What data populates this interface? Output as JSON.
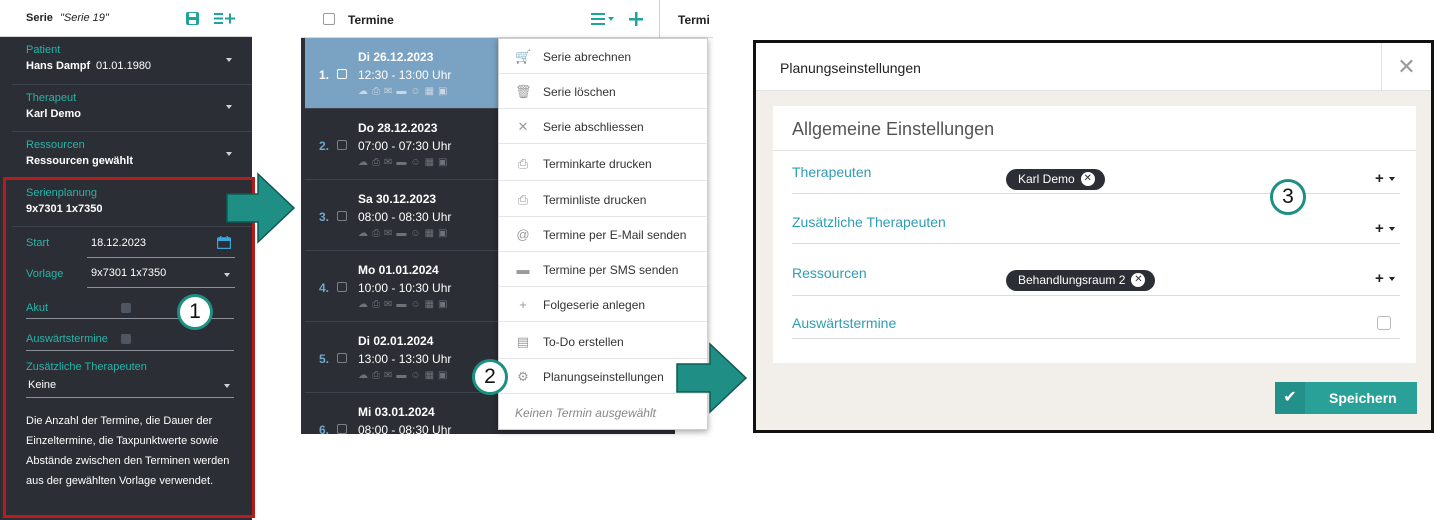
{
  "serie_panel": {
    "header": {
      "label": "Serie",
      "name": "\"Serie 19\""
    },
    "patient": {
      "label": "Patient",
      "name": "Hans Dampf",
      "birthdate": "01.01.1980"
    },
    "therapeut": {
      "label": "Therapeut",
      "value": "Karl Demo"
    },
    "ressourcen": {
      "label": "Ressourcen",
      "value": "Ressourcen gewählt"
    },
    "serienplanung": {
      "label": "Serienplanung",
      "value": "9x7301 1x7350"
    },
    "start": {
      "label": "Start",
      "value": "18.12.2023"
    },
    "vorlage": {
      "label": "Vorlage",
      "value": "9x7301 1x7350"
    },
    "akut": {
      "label": "Akut"
    },
    "auswaertstermine": {
      "label": "Auswärtstermine"
    },
    "zusaetzliche": {
      "label": "Zusätzliche Therapeuten",
      "value": "Keine"
    },
    "description": [
      "Die Anzahl der Termine, die Dauer der",
      "Einzeltermine, die Taxpunktwerte sowie",
      "Abstände zwischen den Terminen werden",
      "aus der gewählten Vorlage verwendet."
    ]
  },
  "termine_panel": {
    "header": {
      "title": "Termine",
      "right_title": "Termi"
    },
    "appointments": [
      {
        "num": "1.",
        "day": "Di 26.12.2023",
        "time": "12:30 - 13:00 Uhr",
        "selected": true
      },
      {
        "num": "2.",
        "day": "Do 28.12.2023",
        "time": "07:00 - 07:30 Uhr",
        "selected": false
      },
      {
        "num": "3.",
        "day": "Sa 30.12.2023",
        "time": "08:00 - 08:30 Uhr",
        "selected": false
      },
      {
        "num": "4.",
        "day": "Mo 01.01.2024",
        "time": "10:00 - 10:30 Uhr",
        "selected": false
      },
      {
        "num": "5.",
        "day": "Di 02.01.2024",
        "time": "13:00 - 13:30 Uhr",
        "selected": false
      },
      {
        "num": "6.",
        "day": "Mi 03.01.2024",
        "time": "08:00 - 08:30 Uhr",
        "selected": false
      }
    ],
    "menu": {
      "items": [
        {
          "label": "Serie abrechnen",
          "icon": "cart-icon",
          "glyph": "🛒"
        },
        {
          "label": "Serie löschen",
          "icon": "trash-icon",
          "glyph": "🗑"
        },
        {
          "label": "Serie abschliessen",
          "icon": "close-icon",
          "glyph": "✕"
        },
        {
          "label": "Terminkarte drucken",
          "icon": "print-icon",
          "glyph": "⎙"
        },
        {
          "label": "Terminliste drucken",
          "icon": "print-icon",
          "glyph": "⎙"
        },
        {
          "label": "Termine per E-Mail senden",
          "icon": "at-icon",
          "glyph": "@"
        },
        {
          "label": "Termine per SMS senden",
          "icon": "sms-icon",
          "glyph": "▬"
        },
        {
          "label": "Folgeserie anlegen",
          "icon": "plus-icon",
          "glyph": "+"
        },
        {
          "label": "To-Do erstellen",
          "icon": "easel-icon",
          "glyph": "▤"
        },
        {
          "label": "Planungseinstellungen",
          "icon": "gear-icon",
          "glyph": "⚙"
        }
      ],
      "footer": "Keinen Termin ausgewählt"
    }
  },
  "settings_dialog": {
    "title": "Planungseinstellungen",
    "section": "Allgemeine Einstellungen",
    "rows": {
      "therapeuten": {
        "label": "Therapeuten",
        "chip": "Karl Demo"
      },
      "zusaetzliche": {
        "label": "Zusätzliche Therapeuten"
      },
      "ressourcen": {
        "label": "Ressourcen",
        "chip": "Behandlungsraum 2"
      },
      "auswaerts": {
        "label": "Auswärtstermine"
      }
    },
    "save_label": "Speichern"
  },
  "callouts": {
    "one": "1",
    "two": "2",
    "three": "3"
  },
  "colors": {
    "accent": "#1fa39c",
    "dark_panel": "#2b2e34",
    "selected_row": "#7aa2c2",
    "callout_border": "#b71c1c",
    "arrow": "#1f8f85"
  }
}
